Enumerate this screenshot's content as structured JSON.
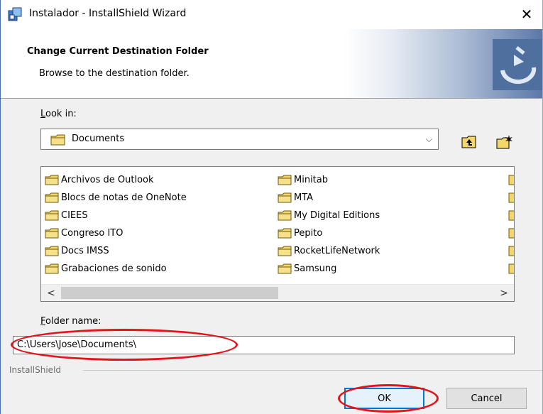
{
  "window": {
    "title": "Instalador - InstallShield Wizard",
    "close_glyph": "✕"
  },
  "header": {
    "heading": "Change Current Destination Folder",
    "subheading": "Browse to the destination folder."
  },
  "look_in": {
    "label_access": "L",
    "label_rest": "ook in:",
    "selected": "Documents",
    "dropdown_glyph": "⌵"
  },
  "folder_list": {
    "column1": [
      "Archivos de Outlook",
      "Blocs de notas de OneNote",
      "CIEES",
      "Congreso ITO",
      "Docs IMSS",
      "Grabaciones de sonido"
    ],
    "column2": [
      "Minitab",
      "MTA",
      "My Digital Editions",
      "Pepito",
      "RocketLifeNetwork",
      "Samsung"
    ],
    "scroll_left": "<",
    "scroll_right": ">"
  },
  "folder_name": {
    "label_access": "F",
    "label_rest": "older name:",
    "value": "C:\\Users\\Jose\\Documents\\"
  },
  "footer": {
    "brand": "InstallShield",
    "ok_label": "OK",
    "cancel_label": "Cancel"
  },
  "colors": {
    "highlight_oval": "#e3141b",
    "default_button_border": "#0078d7"
  }
}
